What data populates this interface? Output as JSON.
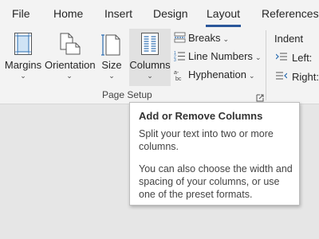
{
  "tabs": [
    {
      "label": "File"
    },
    {
      "label": "Home"
    },
    {
      "label": "Insert"
    },
    {
      "label": "Design"
    },
    {
      "label": "Layout"
    },
    {
      "label": "References"
    }
  ],
  "active_tab": "Layout",
  "accent_color": "#2b579a",
  "page_setup": {
    "group_label": "Page Setup",
    "margins": {
      "label": "Margins",
      "icon": "margins-icon"
    },
    "orientation": {
      "label": "Orientation",
      "icon": "orientation-icon"
    },
    "size": {
      "label": "Size",
      "icon": "size-icon"
    },
    "columns": {
      "label": "Columns",
      "icon": "columns-icon"
    },
    "breaks": {
      "label": "Breaks",
      "icon": "breaks-icon"
    },
    "line_numbers": {
      "label": "Line Numbers",
      "icon": "line-numbers-icon"
    },
    "hyphenation": {
      "label": "Hyphenation",
      "icon": "hyphenation-icon"
    },
    "launcher_icon": "dialog-launcher-icon"
  },
  "paragraph": {
    "indent_title": "Indent",
    "left_label": "Left:",
    "right_label": "Right:"
  },
  "tooltip": {
    "title": "Add or Remove Columns",
    "line1": "Split your text into two or more",
    "line2": "columns.",
    "line3": "You can also choose the width and",
    "line4": "spacing of your columns, or use",
    "line5": "one of the preset formats."
  }
}
